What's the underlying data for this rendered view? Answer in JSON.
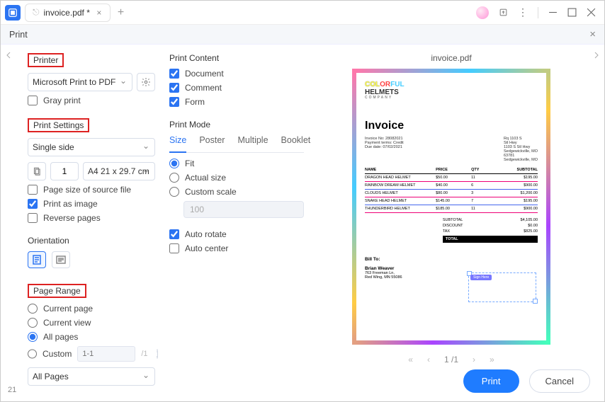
{
  "tab": {
    "title": "invoice.pdf *"
  },
  "dialog": {
    "title": "Print"
  },
  "printer": {
    "label": "Printer",
    "selected": "Microsoft Print to PDF",
    "gray": "Gray print"
  },
  "settings": {
    "label": "Print Settings",
    "mode": "Single side",
    "copies": "1",
    "paper": "A4 21 x 29.7 cm",
    "sourceSize": "Page size of source file",
    "asImage": "Print as image",
    "reverse": "Reverse pages"
  },
  "orientation": {
    "label": "Orientation"
  },
  "pageRange": {
    "label": "Page Range",
    "current": "Current page",
    "view": "Current view",
    "all": "All pages",
    "custom": "Custom",
    "customPlaceholder": "1-1",
    "totalHint": "/1",
    "filter": "All Pages"
  },
  "content": {
    "label": "Print Content",
    "document": "Document",
    "comment": "Comment",
    "form": "Form"
  },
  "printMode": {
    "label": "Print Mode",
    "tabs": [
      "Size",
      "Poster",
      "Multiple",
      "Booklet"
    ],
    "fit": "Fit",
    "actual": "Actual size",
    "customScale": "Custom scale",
    "scaleValue": "100",
    "autoRotate": "Auto rotate",
    "autoCenter": "Auto center"
  },
  "preview": {
    "title": "invoice.pdf",
    "logo1": "COLORFUL",
    "logo2": "HELMETS",
    "logoSub": "COMPANY",
    "heading": "Invoice",
    "meta1": [
      "Invoice No: 28082021",
      "Payment terms: Credit",
      "Due date: 07/02/2021"
    ],
    "meta2": [
      "Rq           1103 S",
      "Stl Hwy",
      "1103 S Stl Hwy",
      "Sedgewickville, MO",
      "63781",
      "Sedgewickville, MO"
    ],
    "headers": [
      "NAME",
      "PRICE",
      "QTY",
      "SUBTOTAL"
    ],
    "rows": [
      [
        "DRAGON HEAD HELMET",
        "$50.00",
        "11",
        "$195.00"
      ],
      [
        "RAINBOW DREAM HELMET",
        "$40.00",
        "6",
        "$900.00"
      ],
      [
        "CLOUDS HELMET",
        "$80.00",
        "3",
        "$1,200.00"
      ],
      [
        "SNAKE HEAD HELMET",
        "$145.00",
        "7",
        "$195.00"
      ],
      [
        "THUNDERBIRD HELMET",
        "$185.00",
        "11",
        "$900.00"
      ]
    ],
    "totals": [
      [
        "SUBTOTAL",
        "$4,105.00"
      ],
      [
        "DISCOUNT",
        "$0.00"
      ],
      [
        "TAX",
        "$825.00"
      ]
    ],
    "grand": "TOTAL",
    "billTo": "Bill To:",
    "billName": "Brian Weaver",
    "billAddr1": "763 Freeman Ln,",
    "billAddr2": "Red Wing, MN 55086",
    "signLabel": "Sign Here"
  },
  "pager": {
    "page": "1",
    "total": "/1"
  },
  "buttons": {
    "print": "Print",
    "cancel": "Cancel"
  },
  "pageNumLeft": "21"
}
